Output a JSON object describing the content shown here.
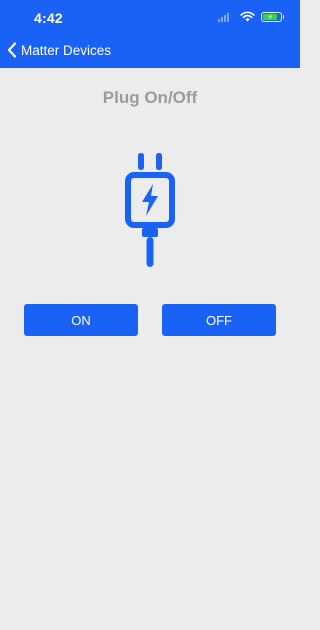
{
  "status_bar": {
    "time": "4:42"
  },
  "nav": {
    "back_label": "Matter Devices"
  },
  "page": {
    "title": "Plug On/Off",
    "icon": "plug-icon"
  },
  "buttons": {
    "on_label": "ON",
    "off_label": "OFF"
  },
  "colors": {
    "accent": "#1a62f5",
    "background": "#ececec",
    "title_gray": "#9b9b9b",
    "battery_green": "#34d34d"
  }
}
